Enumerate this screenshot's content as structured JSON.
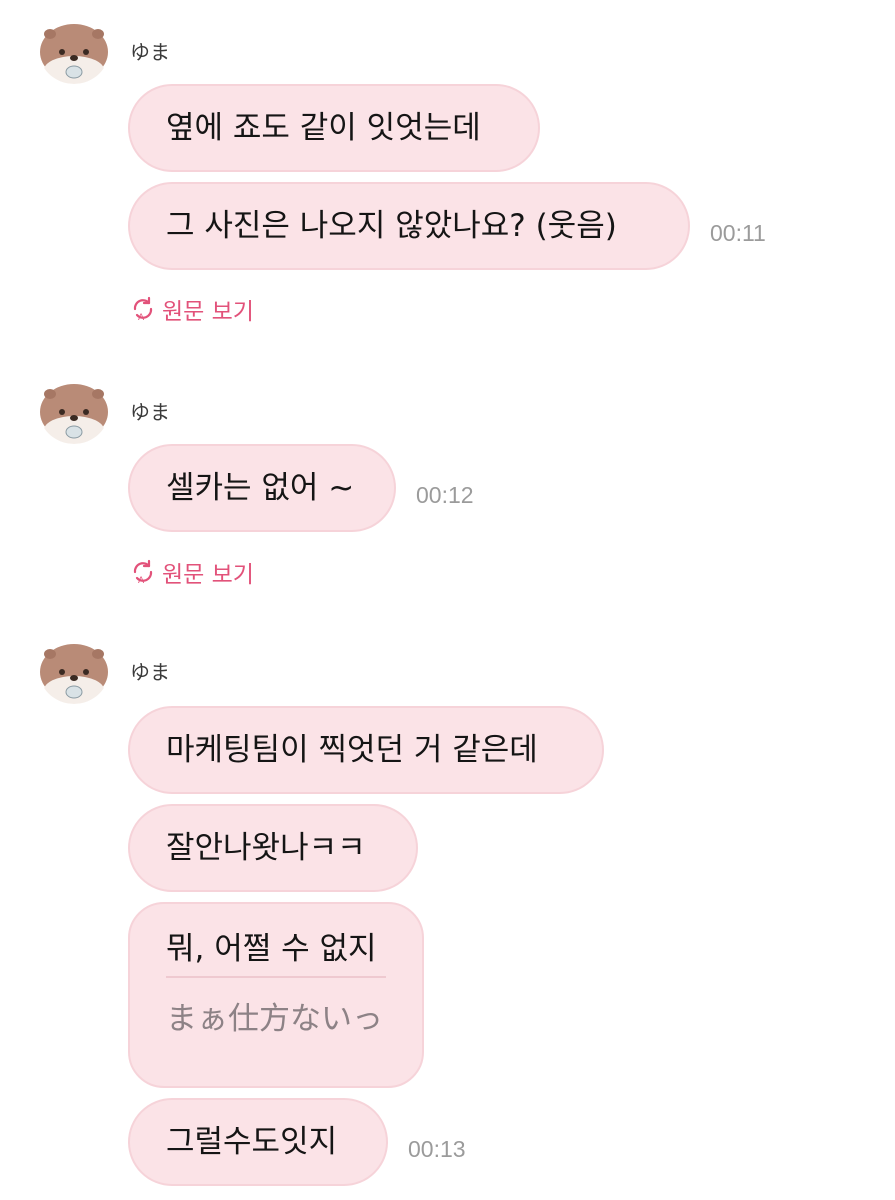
{
  "colors": {
    "bubble_bg": "#fbe3e7",
    "bubble_border": "#f6d3d9",
    "accent": "#e2527a",
    "timestamp": "#9b9b9b"
  },
  "messages": [
    {
      "sender": "ゆま",
      "avatar_icon": "otter-avatar-icon",
      "bubbles": [
        "옆에 죠도 같이 잇엇는데",
        "그 사진은 나오지 않았나요? (웃음)"
      ],
      "time": "00:11",
      "see_original_label": "원문 보기",
      "see_original_icon": "translate-refresh-icon"
    },
    {
      "sender": "ゆま",
      "avatar_icon": "otter-avatar-icon",
      "bubbles": [
        "셀카는 없어 ~"
      ],
      "time": "00:12",
      "see_original_label": "원문 보기",
      "see_original_icon": "translate-refresh-icon"
    },
    {
      "sender": "ゆま",
      "avatar_icon": "otter-avatar-icon",
      "bubbles": [
        "마케팅팀이 찍엇던 거 같은데",
        "잘안나왓나ㅋㅋ",
        "뭐, 어쩔 수 없지",
        "그럴수도잇지"
      ],
      "translation": "まぁ仕方ないっ",
      "time": "00:13"
    }
  ]
}
